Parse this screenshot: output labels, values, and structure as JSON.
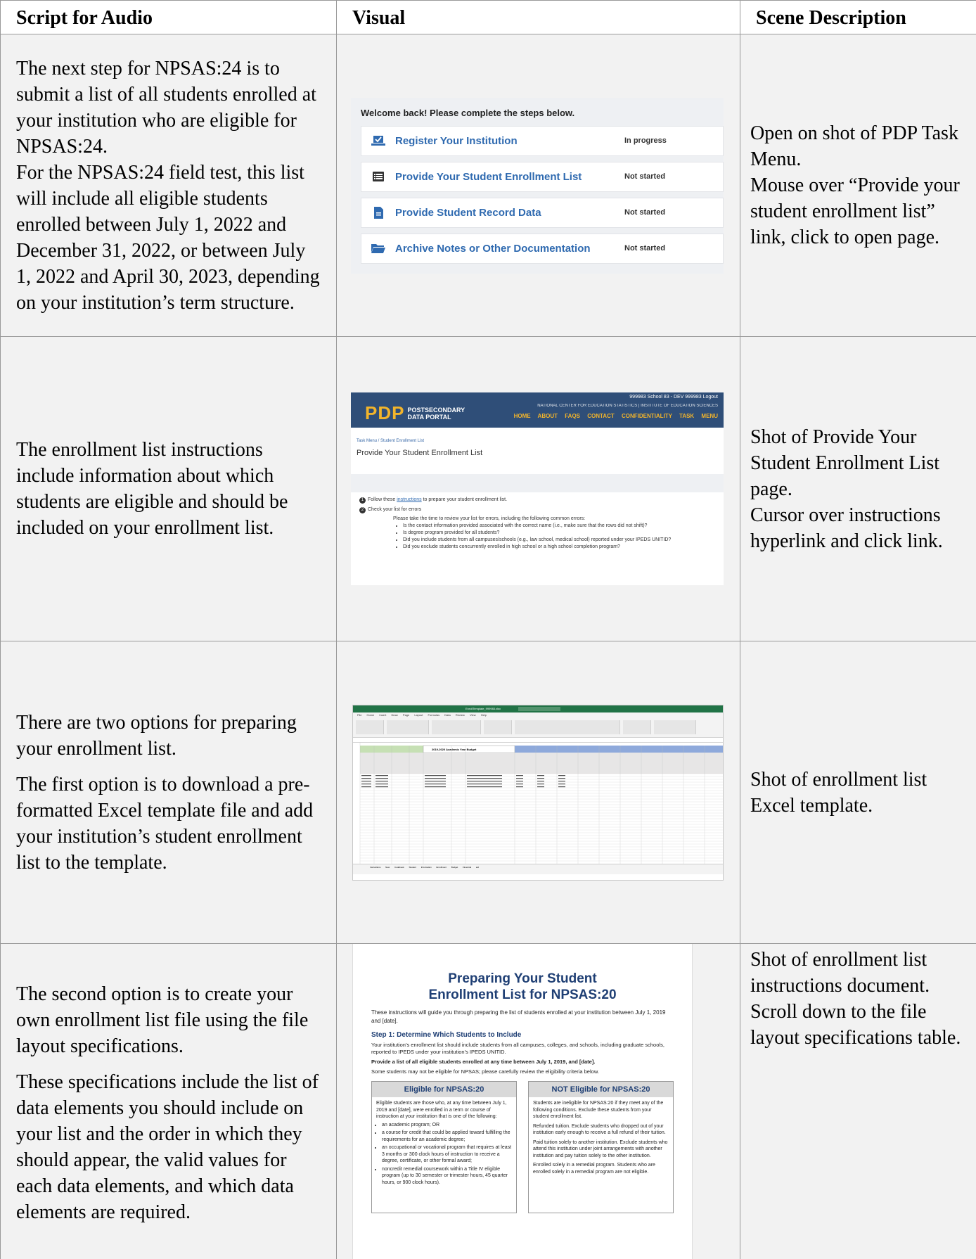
{
  "headers": {
    "script": "Script for Audio",
    "visual": "Visual",
    "scene": "Scene Description"
  },
  "rows": [
    {
      "script": [
        "The next step for NPSAS:24 is to submit a list of all students enrolled at your institution who are eligible for NPSAS:24.",
        "For the NPSAS:24 field test, this list will include all eligible students enrolled between July 1, 2022 and December 31, 2022, or between July 1, 2022 and April 30, 2023, depending on your institution’s term structure."
      ],
      "scene": [
        "Open on shot of PDP Task Menu.",
        "Mouse over “Provide your student enrollment list” link, click to open page."
      ]
    },
    {
      "script": [
        "The enrollment list instructions include information about which students are eligible and should be included on your enrollment list."
      ],
      "scene": [
        "Shot of Provide Your Student Enrollment List page.",
        "Cursor over instructions hyperlink and click link."
      ]
    },
    {
      "script": [
        "There are two options for preparing your enrollment list.",
        "The first option is to download a pre-formatted Excel template file and add your institution’s student enrollment list to the template."
      ],
      "scene": [
        "Shot of enrollment list Excel template."
      ]
    },
    {
      "script": [
        "The second option is to create your own enrollment list file using the file layout specifications.",
        "These specifications include the list of data elements you should include on your list and the order in which they should appear, the valid values for each data elements, and which data elements are required."
      ],
      "scene": [
        "Shot of enrollment list instructions document. Scroll down to the file layout specifications table."
      ]
    }
  ],
  "task_menu": {
    "welcome": "Welcome back! Please complete the steps below.",
    "tasks": [
      {
        "label": "Register Your Institution",
        "status": "In progress",
        "icon": "laptop-check-icon"
      },
      {
        "label": "Provide Your Student Enrollment List",
        "status": "Not started",
        "icon": "list-icon"
      },
      {
        "label": "Provide Student Record Data",
        "status": "Not started",
        "icon": "document-icon"
      },
      {
        "label": "Archive Notes or Other Documentation",
        "status": "Not started",
        "icon": "folder-icon"
      }
    ]
  },
  "pdp": {
    "logo_big": "PDP",
    "logo_small_1": "POSTSECONDARY",
    "logo_small_2": "DATA PORTAL",
    "account": "999983 School 83 - DEV 999983 Logout",
    "nces": "NATIONAL CENTER FOR EDUCATION STATISTICS | INSTITUTE OF EDUCATION SCIENCES",
    "nav": "HOME ABOUT FAQS CONTACT CONFIDENTIALITY TASK MENU",
    "breadcrumb": "Task Menu / Student Enrollment List",
    "page_title": "Provide Your Student Enrollment List",
    "step1_pre": "Follow these ",
    "step1_link": "instructions",
    "step1_post": " to prepare your student enrollment list.",
    "step2": "Check your list for errors",
    "step2_intro": "Please take the time to review your list for errors, including the following common errors:",
    "errors": [
      "Is the contact information provided associated with the correct name (i.e., make sure that the rows did not shift)?",
      "Is degree program provided for all students?",
      "Did you include students from all campuses/schools (e.g., law school, medical school) reported under your IPEDS UNITID?",
      "Did you exclude students concurrently enrolled in high school or a high school completion program?"
    ]
  },
  "excel": {
    "file_name": "EnrollTemplate_999983.xlsx",
    "menu": "File Home Insert Draw Page Layout Formulas Data Review View Help",
    "sheet_header": "2019-2020 Academic Year Budget",
    "tabs": "Instructions New Codebook Student Information Enrollment Budget Financial aid"
  },
  "doc": {
    "title_1": "Preparing Your Student",
    "title_2": "Enrollment List for NPSAS:20",
    "intro": "These instructions will guide you through preparing the list of students enrolled at your institution between July 1, 2019 and [date].",
    "step1_heading": "Step 1: Determine Which Students to Include",
    "step1_body": "Your institution’s enrollment list should include students from all campuses, colleges, and schools, including graduate schools, reported to IPEDS under your institution’s IPEDS UNITID.",
    "step1_bold": "Provide a list of all eligible students enrolled at any time between July 1, 2019, and [date].",
    "step1_note": "Some students may not be eligible for NPSAS; please carefully review the eligibility criteria below.",
    "eligible_title": "Eligible for NPSAS:20",
    "eligible_intro": "Eligible students are those who, at any time between July 1, 2019 and [date], were enrolled in a term or course of instruction at your institution that is one of the following:",
    "eligible_items": [
      "an academic program; OR",
      "a course for credit that could be applied toward fulfilling the requirements for an academic degree;",
      "an occupational or vocational program that requires at least 3 months or 300 clock hours of instruction to receive a degree, certificate, or other formal award;",
      "noncredit remedial coursework within a Title IV eligible program (up to 30 semester or trimester hours, 45 quarter hours, or 900 clock hours)."
    ],
    "not_eligible_title": "NOT Eligible for NPSAS:20",
    "not_eligible_intro": "Students are ineligible for NPSAS:20 if they meet any of the following conditions. Exclude these students from your student enrollment list.",
    "not_eligible_items": [
      "Refunded tuition. Exclude students who dropped out of your institution early enough to receive a full refund of their tuition.",
      "Paid tuition solely to another institution. Exclude students who attend this institution under joint arrangements with another institution and pay tuition solely to the other institution.",
      "Enrolled solely in a remedial program. Students who are enrolled solely in a remedial program are not eligible."
    ]
  }
}
